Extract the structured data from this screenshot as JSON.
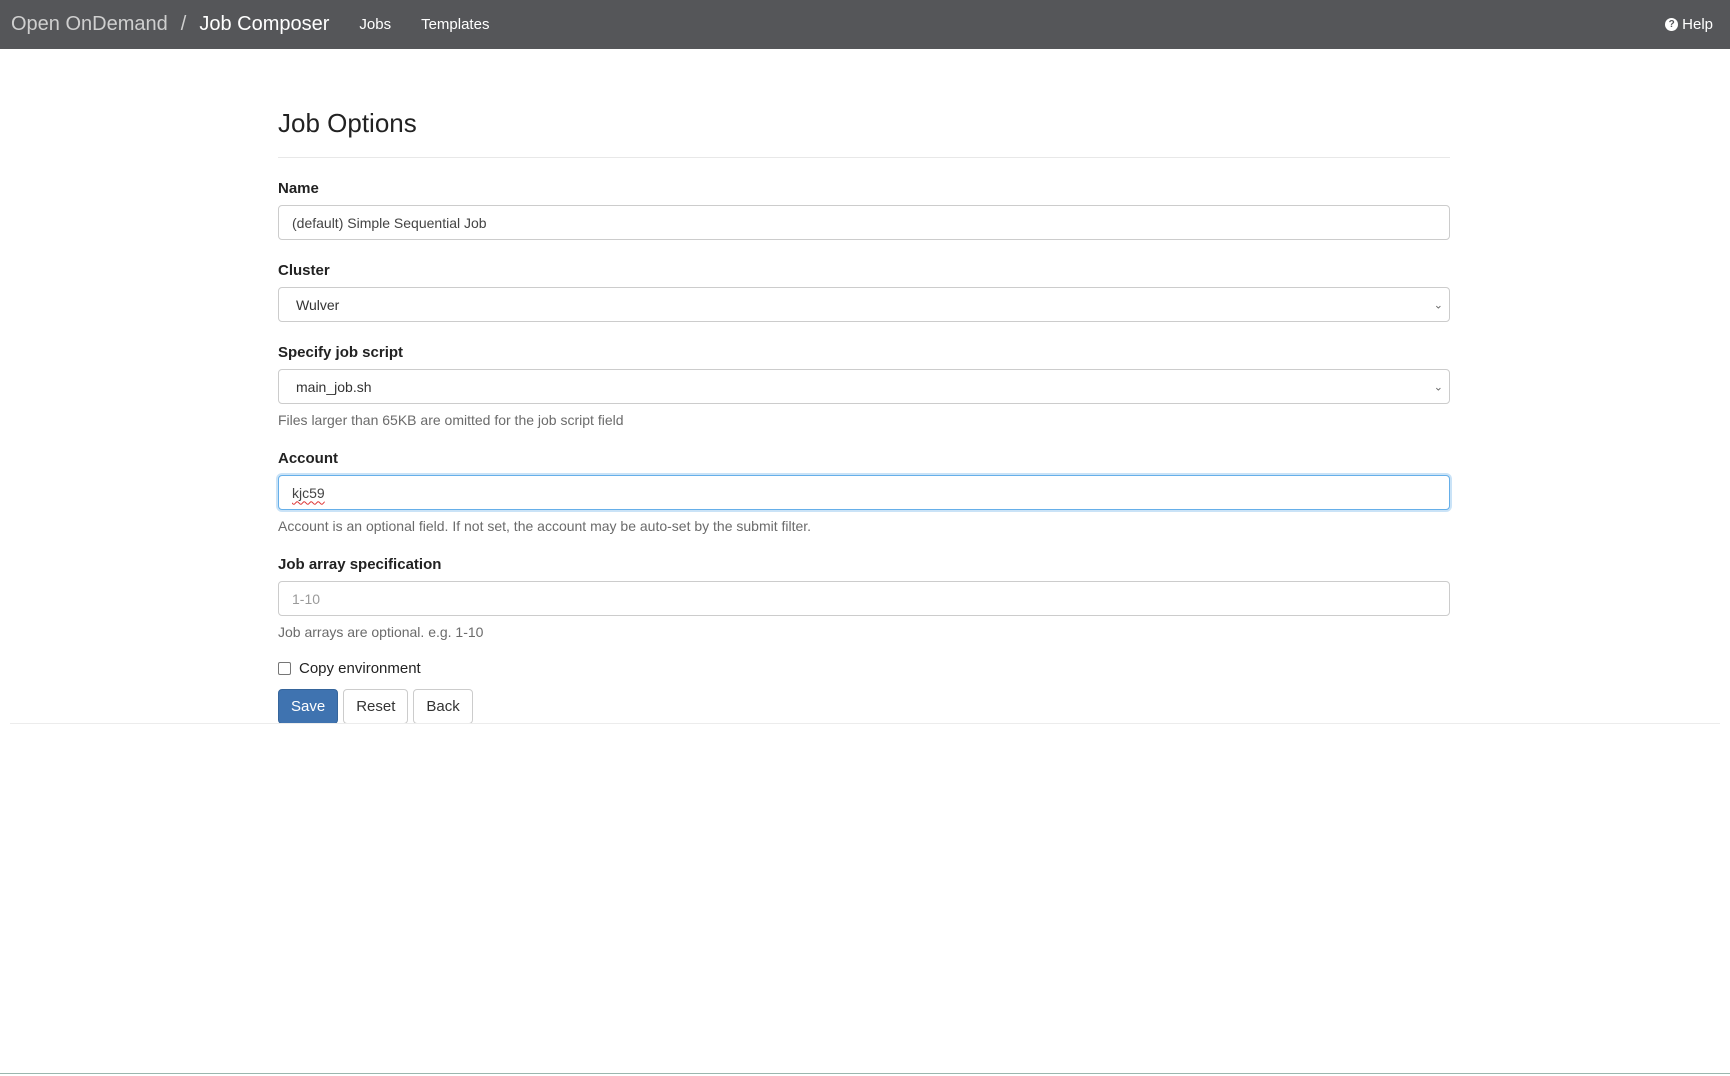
{
  "navbar": {
    "brand": "Open OnDemand",
    "separator": "/",
    "app_name": "Job Composer",
    "links": [
      "Jobs",
      "Templates"
    ],
    "help_label": "Help",
    "help_icon": "question-circle-icon"
  },
  "page": {
    "title": "Job Options"
  },
  "form": {
    "name": {
      "label": "Name",
      "value": "(default) Simple Sequential Job"
    },
    "cluster": {
      "label": "Cluster",
      "selected": "Wulver"
    },
    "job_script": {
      "label": "Specify job script",
      "selected": "main_job.sh",
      "help": "Files larger than 65KB are omitted for the job script field"
    },
    "account": {
      "label": "Account",
      "value": "kjc59",
      "help": "Account is an optional field. If not set, the account may be auto-set by the submit filter."
    },
    "job_array": {
      "label": "Job array specification",
      "placeholder": "1-10",
      "help": "Job arrays are optional. e.g. 1-10"
    },
    "copy_environment": {
      "label": "Copy environment",
      "checked": false
    },
    "buttons": {
      "save": "Save",
      "reset": "Reset",
      "back": "Back"
    }
  },
  "colors": {
    "navbar_bg": "#555659",
    "primary": "#3f73b0",
    "focus": "#66afe9"
  }
}
